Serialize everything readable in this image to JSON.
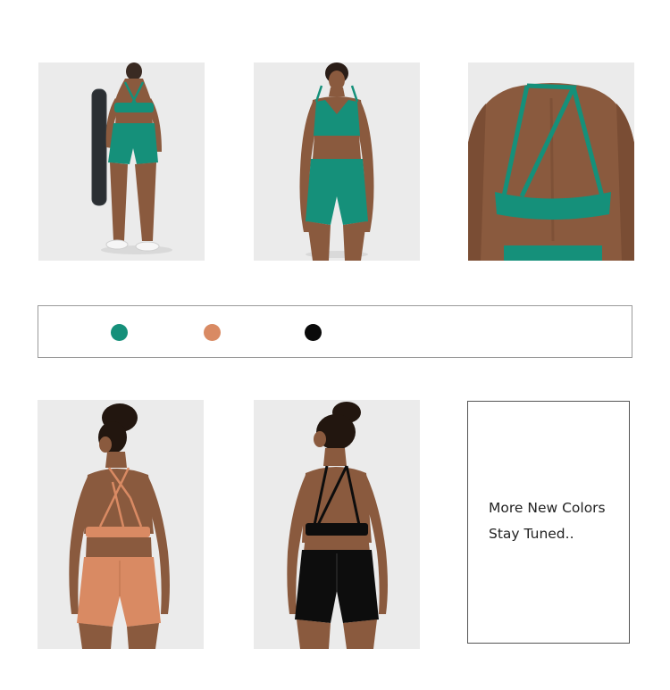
{
  "photos": [
    {
      "name": "teal-set-back-view",
      "icon": "model-back-yoga-mat"
    },
    {
      "name": "teal-set-front-view",
      "icon": "model-front"
    },
    {
      "name": "teal-bra-back-closeup",
      "icon": "strappy-back-detail"
    },
    {
      "name": "orange-set-back-view",
      "icon": "model-back"
    },
    {
      "name": "black-set-back-view",
      "icon": "model-back"
    }
  ],
  "colors": {
    "teal": "#15907a",
    "orange": "#d98a63",
    "black": "#0d0d0d",
    "skin": "#8a5a3e",
    "photo_bg": "#ebebeb"
  },
  "swatches": [
    {
      "name": "teal",
      "color": "#15907a"
    },
    {
      "name": "orange",
      "color": "#d98a63"
    },
    {
      "name": "black",
      "color": "#0a0a0a"
    }
  ],
  "info": {
    "line1": "More New Colors",
    "line2": "Stay Tuned.."
  }
}
